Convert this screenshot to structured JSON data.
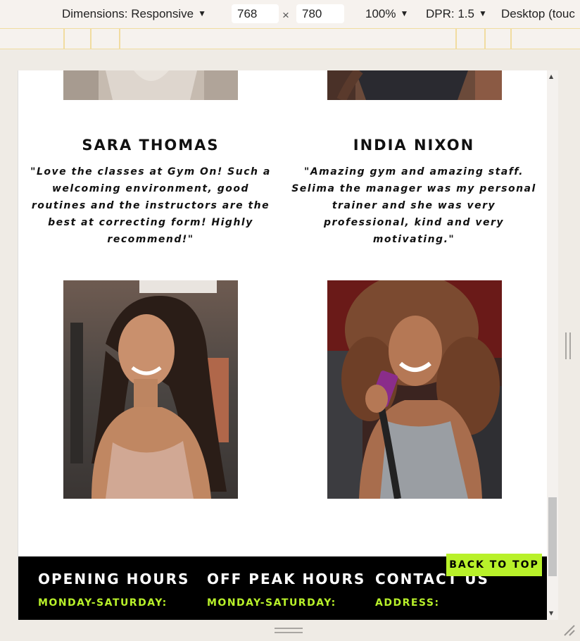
{
  "devtools": {
    "dimensions_label": "Dimensions: Responsive",
    "width": "768",
    "times": "×",
    "height": "780",
    "zoom": "100%",
    "dpr": "DPR: 1.5",
    "device_mode": "Desktop (touc"
  },
  "testimonials": [
    {
      "name": "SARA THOMAS",
      "quote": "\"Love the classes at Gym On! Such a welcoming environment, good routines and the instructors are the best at correcting form! Highly recommend!\""
    },
    {
      "name": "INDIA NIXON",
      "quote": "\"Amazing gym and amazing staff. Selima the manager was my personal trainer and she was very professional, kind and very motivating.\""
    }
  ],
  "footer": {
    "col1": {
      "title": "OPENING HOURS",
      "sub": "MONDAY-SATURDAY:"
    },
    "col2": {
      "title": "OFF PEAK HOURS",
      "sub": "MONDAY-SATURDAY:"
    },
    "col3": {
      "title": "CONTACT US",
      "sub": "ADDRESS:"
    },
    "back_to_top": "BACK TO TOP"
  },
  "colors": {
    "accent": "#b8f12a",
    "footer_bg": "#000000"
  }
}
